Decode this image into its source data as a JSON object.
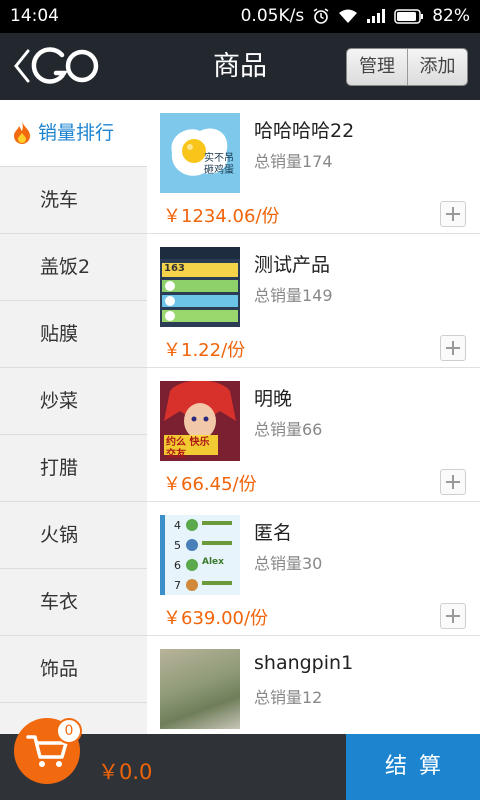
{
  "status_bar": {
    "time": "14:04",
    "network_speed": "0.05K/s",
    "battery": "82%"
  },
  "header": {
    "logo_text": "GO",
    "title": "商品",
    "manage_label": "管理",
    "add_label": "添加"
  },
  "sidebar": {
    "items": [
      {
        "label": "销量排行",
        "active": true
      },
      {
        "label": "洗车"
      },
      {
        "label": "盖饭2"
      },
      {
        "label": "贴膜"
      },
      {
        "label": "炒菜"
      },
      {
        "label": "打腊"
      },
      {
        "label": "火锅"
      },
      {
        "label": "车衣"
      },
      {
        "label": "饰品"
      }
    ]
  },
  "products": [
    {
      "name": "哈哈哈哈22",
      "sales": "总销量174",
      "price": "￥1234.06",
      "unit": "/份",
      "thumb_text": "实不吊 砸鸡蛋"
    },
    {
      "name": "测试产品",
      "sales": "总销量149",
      "price": "￥1.22",
      "unit": "/份",
      "thumb_text": "163"
    },
    {
      "name": "明晚",
      "sales": "总销量66",
      "price": "￥66.45",
      "unit": "/份",
      "thumb_text": "约么 快乐交友"
    },
    {
      "name": "匿名",
      "sales": "总销量30",
      "price": "￥639.00",
      "unit": "/份",
      "thumb_text": "Alex"
    },
    {
      "name": "shangpin1",
      "sales": "总销量12",
      "price": "",
      "unit": "",
      "thumb_text": ""
    }
  ],
  "cart": {
    "count": "0",
    "total": "￥0.0",
    "checkout_label": "结算"
  },
  "colors": {
    "accent_blue": "#1d84d0",
    "price_orange": "#f0640a",
    "header_bg": "#23282f"
  }
}
